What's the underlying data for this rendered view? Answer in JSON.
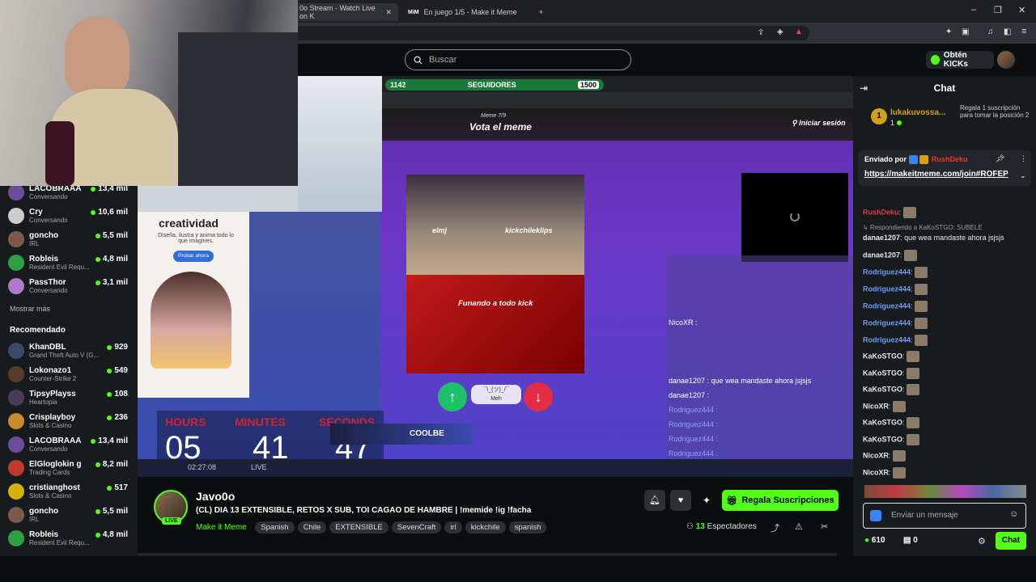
{
  "browser": {
    "tabs": [
      {
        "label": "0o Stream - Watch Live on K",
        "active": true
      },
      {
        "label": "En juego 1/5 - Make it Meme",
        "active": false
      }
    ],
    "new_tab": "+",
    "window_min": "–",
    "window_max": "❐",
    "window_close": "✕"
  },
  "topnav": {
    "search_placeholder": "Buscar",
    "kicks_label": "Obtén KICKs"
  },
  "sidebar": {
    "following": [
      {
        "name": "LACOBRAAA",
        "sub": "Conversando",
        "count": "13,4 mil",
        "color": "#6b4e9b"
      },
      {
        "name": "Cry",
        "sub": "Conversando",
        "count": "10,6 mil",
        "color": "#cccccc"
      },
      {
        "name": "goncho",
        "sub": "IRL",
        "count": "5,5 mil",
        "color": "#7a5a4a"
      },
      {
        "name": "Robleis",
        "sub": "Resident Evil Requ...",
        "count": "4,8 mil",
        "color": "#2ea043"
      },
      {
        "name": "PassThor",
        "sub": "Conversando",
        "count": "3,1 mil",
        "color": "#b07acc"
      }
    ],
    "show_more": "Mostrar más",
    "recommended_title": "Recomendado",
    "recommended": [
      {
        "name": "KhanDBL",
        "sub": "Grand Theft Auto V (G...",
        "count": "929",
        "color": "#3a4a6a"
      },
      {
        "name": "Lokonazo1",
        "sub": "Counter-Strike 2",
        "count": "549",
        "color": "#5a3a2a"
      },
      {
        "name": "TipsyPlayss",
        "sub": "Heartopia",
        "count": "108",
        "color": "#4a3a5a"
      },
      {
        "name": "Crisplayboy",
        "sub": "Slots & Casino",
        "count": "236",
        "color": "#c98a2a"
      },
      {
        "name": "LACOBRAAA",
        "sub": "Conversando",
        "count": "13,4 mil",
        "color": "#6b4e9b"
      },
      {
        "name": "ElGloglokin g",
        "sub": "Trading Cards",
        "count": "8,2 mil",
        "color": "#c0392b"
      },
      {
        "name": "cristianghost",
        "sub": "Slots & Casino",
        "count": "517",
        "color": "#d4b106"
      },
      {
        "name": "goncho",
        "sub": "IRL",
        "count": "5,5 mil",
        "color": "#7a5a4a"
      },
      {
        "name": "Robleis",
        "sub": "Resident Evil Requ...",
        "count": "4,8 mil",
        "color": "#2ea043"
      }
    ]
  },
  "video": {
    "overlay_counter": "1142",
    "overlay_label": "SEGUIDORES",
    "overlay_goal": "1500",
    "meme_round": "Meme 7/9",
    "vote_title": "Vota el meme",
    "login": "Iniciar sesión",
    "meme_top_left": "elmj",
    "meme_top_right": "kickchileklips",
    "meme_bottom": "Funando a todo kick",
    "vote_meh": "Meh",
    "vote_face": "¯\\_(ツ)_/¯",
    "ad_title": "creatividad",
    "ad_sub": "Diseña, ilustra y anima todo lo que imagines.",
    "ad_button": "Probar ahora",
    "timer_labels": [
      "HOURS",
      "MINUTES",
      "SECONDS"
    ],
    "timer_values": [
      "05",
      "41",
      "47"
    ],
    "uptime": "02:27:08",
    "live_tag": "LIVE",
    "inner_chat": [
      "NicoXR :",
      "danae1207 : que wea mandaste ahora jsjsjs",
      "danae1207 :",
      "Rodriguez444 :",
      "Rodriguez444 :",
      "Rodriguez444 :",
      "Rodriguez444 :"
    ],
    "coolbe": "COOLBE"
  },
  "stream": {
    "streamer": "Javo0o",
    "live_badge": "LIVE",
    "title": "(CL) DIA 13 EXTENSIBLE, RETOS X SUB, TOI CAGAO DE HAMBRE | !memide !ig !facha",
    "category": "Make it Meme",
    "tags": [
      "Spanish",
      "Chile",
      "EXTENSIBLE",
      "SevenCraft",
      "irl",
      "kickchile",
      "spanish"
    ],
    "viewers_count": "13",
    "viewers_label": "Espectadores",
    "gift_button": "Regala Suscripciones"
  },
  "chat": {
    "title": "Chat",
    "gift_rank": "1",
    "gift_user": "lukakuvossa...",
    "gift_count": "1",
    "gift_info": "Regala 1 suscripción para tomar la posición 2",
    "pinned_by": "Enviado por",
    "pinned_user": "RushDeku",
    "pinned_link": "https://makeitmeme.com/join#ROFEP",
    "messages": [
      {
        "user": "RushDeku",
        "text": "",
        "color": "#e03a3a"
      },
      {
        "user": "RushDeku",
        "text": "",
        "color": "#e03a3a"
      },
      {
        "user": "",
        "text": "Respondiendo a KaKoSTGO: SUBELE",
        "color": "#9a9a9a",
        "reply": true
      },
      {
        "user": "danae1207",
        "text": "que wea mandaste ahora jsjsjs",
        "color": "#e6e6e6"
      },
      {
        "user": "danae1207",
        "text": "",
        "color": "#e6e6e6"
      },
      {
        "user": "Rodriguez444",
        "text": "",
        "color": "#6f9cf2"
      },
      {
        "user": "Rodriguez444",
        "text": "",
        "color": "#6f9cf2"
      },
      {
        "user": "Rodriguez444",
        "text": "",
        "color": "#6f9cf2"
      },
      {
        "user": "Rodriguez444",
        "text": "",
        "color": "#6f9cf2"
      },
      {
        "user": "Rodriguez444",
        "text": "",
        "color": "#6f9cf2"
      },
      {
        "user": "KaKoSTGO",
        "text": "",
        "color": "#e6e6e6"
      },
      {
        "user": "KaKoSTGO",
        "text": "",
        "color": "#e6e6e6"
      },
      {
        "user": "KaKoSTGO",
        "text": "",
        "color": "#e6e6e6"
      },
      {
        "user": "NicoXR",
        "text": "",
        "color": "#e6e6e6"
      },
      {
        "user": "KaKoSTGO",
        "text": "",
        "color": "#e6e6e6"
      },
      {
        "user": "KaKoSTGO",
        "text": "",
        "color": "#e6e6e6"
      },
      {
        "user": "NicoXR",
        "text": "",
        "color": "#e6e6e6"
      },
      {
        "user": "NicoXR",
        "text": "",
        "color": "#e6e6e6"
      }
    ],
    "input_placeholder": "Enviar un mensaje",
    "points": "610",
    "gifts": "0",
    "send_label": "Chat"
  },
  "colors": {
    "accent": "#53fc18",
    "bg": "#0b0e0f",
    "panel": "#181b1d"
  }
}
